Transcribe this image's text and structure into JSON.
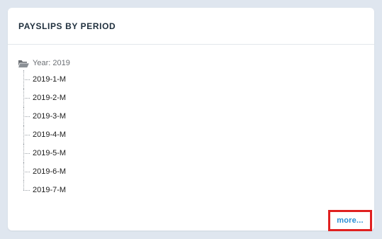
{
  "card": {
    "title": "PAYSLIPS BY PERIOD"
  },
  "tree": {
    "year_label": "Year: 2019",
    "folder_icon": "folder-open-icon",
    "periods": [
      "2019-1-M",
      "2019-2-M",
      "2019-3-M",
      "2019-4-M",
      "2019-5-M",
      "2019-6-M",
      "2019-7-M"
    ]
  },
  "footer": {
    "more_label": "more..."
  },
  "colors": {
    "background": "#dfe6ef",
    "card": "#ffffff",
    "title": "#1f2f3d",
    "link": "#2a8fd6",
    "highlight_border": "#e02020"
  }
}
